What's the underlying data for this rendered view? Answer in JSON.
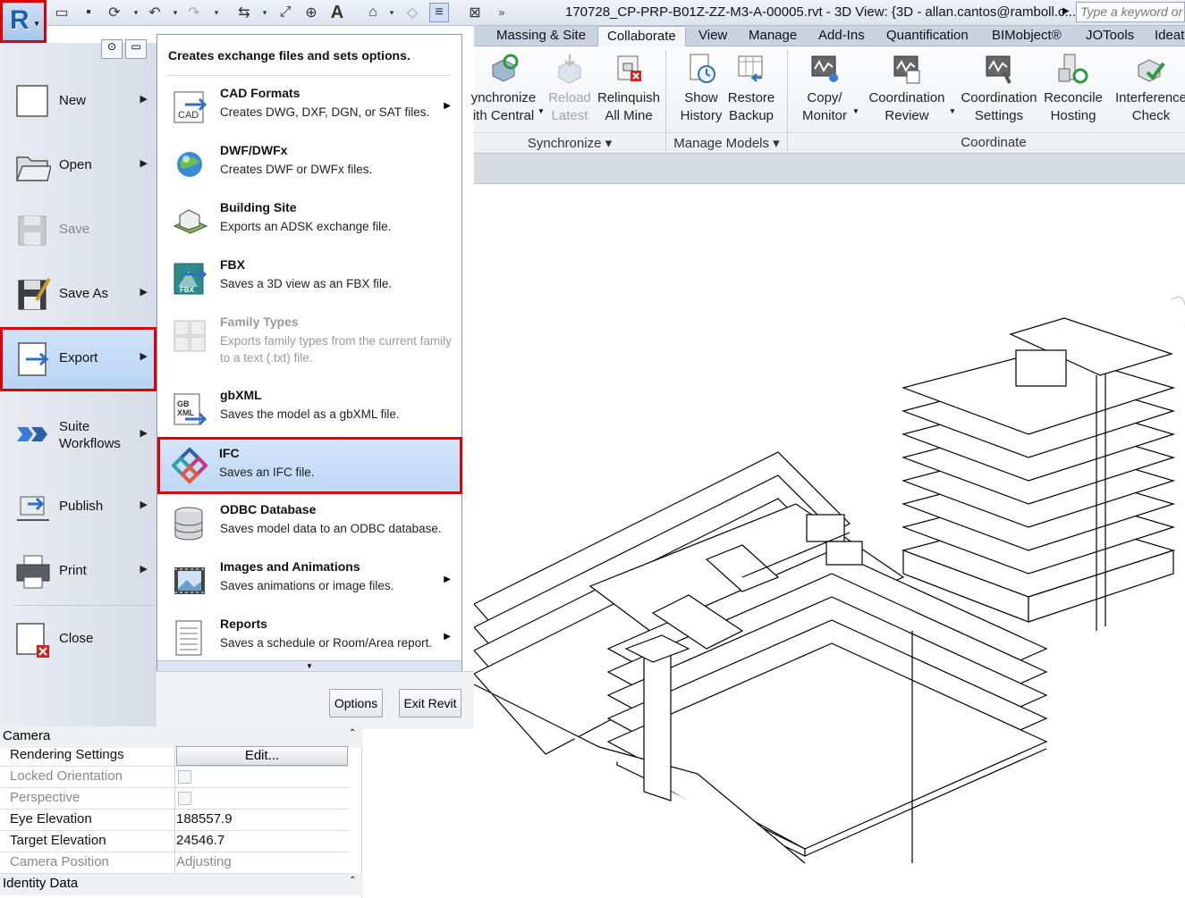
{
  "app": {
    "title": "170728_CP-PRP-B01Z-ZZ-M3-A-00005.rvt - 3D View: {3D - allan.cantos@ramboll.c...",
    "search_placeholder": "Type a keyword or ph"
  },
  "ribbon": {
    "tabs": [
      "Massing & Site",
      "Collaborate",
      "View",
      "Manage",
      "Add-Ins",
      "Quantification",
      "BIMobject®",
      "JOTools",
      "Ideat"
    ],
    "active_tab": "Collaborate",
    "buttons": [
      {
        "label1": "ynchronize",
        "label2": "ith Central",
        "icon": "synchronize-icon"
      },
      {
        "label1": "Reload",
        "label2": "Latest",
        "icon": "reload-icon"
      },
      {
        "label1": "Relinquish",
        "label2": "All Mine",
        "icon": "relinquish-icon"
      },
      {
        "label1": "Show",
        "label2": "History",
        "icon": "history-icon"
      },
      {
        "label1": "Restore",
        "label2": "Backup",
        "icon": "backup-icon"
      },
      {
        "label1": "Copy/",
        "label2": "Monitor",
        "icon": "copy-monitor-icon"
      },
      {
        "label1": "Coordination",
        "label2": "Review",
        "icon": "coordination-review-icon"
      },
      {
        "label1": "Coordination",
        "label2": "Settings",
        "icon": "coordination-settings-icon"
      },
      {
        "label1": "Reconcile",
        "label2": "Hosting",
        "icon": "reconcile-icon"
      },
      {
        "label1": "Interference",
        "label2": "Check",
        "icon": "interference-icon"
      }
    ],
    "panels": [
      "Synchronize",
      "Manage Models",
      "Coordinate"
    ]
  },
  "app_menu": {
    "items": [
      {
        "label": "New",
        "icon": "new-icon",
        "arrow": true
      },
      {
        "label": "Open",
        "icon": "open-folder-icon",
        "arrow": true
      },
      {
        "label": "Save",
        "icon": "save-icon",
        "arrow": false
      },
      {
        "label": "Save As",
        "icon": "save-as-icon",
        "arrow": true
      },
      {
        "label": "Export",
        "icon": "export-icon",
        "arrow": true
      },
      {
        "label": "Suite\nWorkflows",
        "icon": "suite-workflows-icon",
        "arrow": true
      },
      {
        "label": "Publish",
        "icon": "publish-icon",
        "arrow": true
      },
      {
        "label": "Print",
        "icon": "print-icon",
        "arrow": true
      },
      {
        "label": "Close",
        "icon": "close-doc-icon",
        "arrow": false
      }
    ],
    "export_header": "Creates exchange files and sets options.",
    "export_items": [
      {
        "title": "CAD Formats",
        "desc": "Creates DWG, DXF, DGN, or SAT files.",
        "icon": "cad-icon"
      },
      {
        "title": "DWF/DWFx",
        "desc": "Creates DWF or DWFx files.",
        "icon": "dwf-icon"
      },
      {
        "title": "Building Site",
        "desc": "Exports an ADSK exchange file.",
        "icon": "building-site-icon"
      },
      {
        "title": "FBX",
        "desc": "Saves a 3D view as an FBX file.",
        "icon": "fbx-icon"
      },
      {
        "title": "Family Types",
        "desc": "Exports family types from the current family to a text (.txt) file.",
        "icon": "family-types-icon"
      },
      {
        "title": "gbXML",
        "desc": "Saves the model as a gbXML file.",
        "icon": "gbxml-icon"
      },
      {
        "title": "IFC",
        "desc": "Saves an IFC file.",
        "icon": "ifc-icon"
      },
      {
        "title": "ODBC Database",
        "desc": "Saves model data to an ODBC database.",
        "icon": "database-icon"
      },
      {
        "title": "Images and Animations",
        "desc": "Saves animations or image files.",
        "icon": "images-icon"
      },
      {
        "title": "Reports",
        "desc": "Saves a schedule or Room/Area report.",
        "icon": "reports-icon"
      }
    ],
    "options_label": "Options",
    "exit_label": "Exit Revit"
  },
  "properties": {
    "group_camera": "Camera",
    "group_identity": "Identity Data",
    "edit_label": "Edit...",
    "rows": [
      {
        "key": "Rendering Settings",
        "value": ""
      },
      {
        "key": "Locked Orientation",
        "value": ""
      },
      {
        "key": "Perspective",
        "value": ""
      },
      {
        "key": "Eye Elevation",
        "value": "188557.9"
      },
      {
        "key": "Target Elevation",
        "value": "24546.7"
      },
      {
        "key": "Camera Position",
        "value": "Adjusting"
      }
    ]
  }
}
